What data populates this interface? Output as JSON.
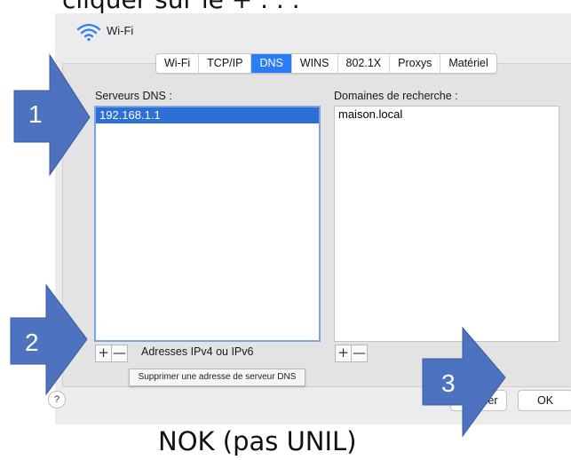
{
  "header_text": "cliquer sur le + . . .",
  "window": {
    "title": "Wi-Fi",
    "wifi_icon": "wifi-icon"
  },
  "tabs": [
    {
      "label": "Wi-Fi",
      "active": false
    },
    {
      "label": "TCP/IP",
      "active": false
    },
    {
      "label": "DNS",
      "active": true
    },
    {
      "label": "WINS",
      "active": false
    },
    {
      "label": "802.1X",
      "active": false
    },
    {
      "label": "Proxys",
      "active": false
    },
    {
      "label": "Matériel",
      "active": false
    }
  ],
  "dns": {
    "label": "Serveurs DNS :",
    "servers": [
      "192.168.1.1"
    ],
    "address_hint": "Adresses IPv4 ou IPv6",
    "plus": "+",
    "minus": "—",
    "tooltip": "Supprimer une adresse de serveur DNS"
  },
  "search": {
    "label": "Domaines de recherche :",
    "domains": [
      "maison.local"
    ],
    "plus": "+",
    "minus": "—"
  },
  "footer": {
    "help": "?",
    "cancel_label": "Annuler",
    "ok_label": "OK"
  },
  "callouts": [
    "1",
    "2",
    "3"
  ],
  "caption": "NOK (pas UNIL)",
  "colors": {
    "accent": "#2b7df6",
    "callout": "#4d72c0",
    "selection": "#2c6fd6"
  }
}
